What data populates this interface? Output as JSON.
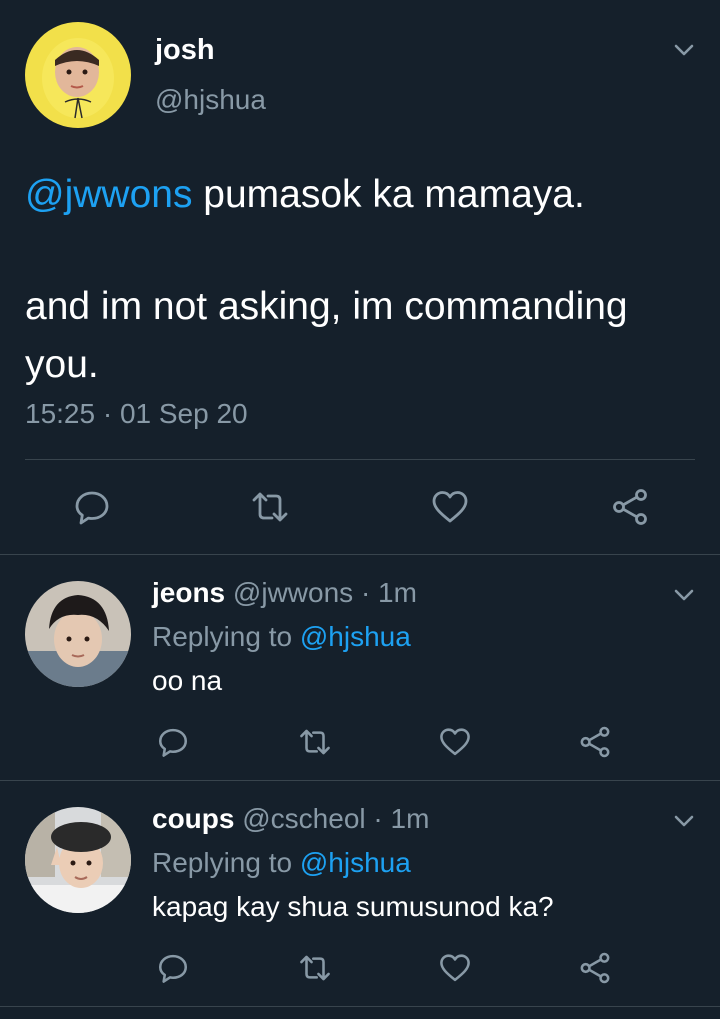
{
  "main": {
    "name": "josh",
    "handle": "@hjshua",
    "mention": "@jwwons",
    "text_line1": " pumasok ka mamaya.",
    "text_para2": "and im not asking, im commanding you.",
    "timestamp": "15:25 · 01 Sep 20"
  },
  "replies": [
    {
      "name": "jeons",
      "handle": "@jwwons",
      "time": "· 1m",
      "replying_label": "Replying to ",
      "replying_to": "@hjshua",
      "text": "oo na"
    },
    {
      "name": "coups",
      "handle": "@cscheol",
      "time": "· 1m",
      "replying_label": "Replying to ",
      "replying_to": "@hjshua",
      "text": "kapag kay shua sumusunod ka?"
    }
  ],
  "colors": {
    "background": "#15202b",
    "muted": "#8899a6",
    "accent": "#1da1f2",
    "divider": "#38444d"
  },
  "icons": [
    "chevron-down-icon",
    "reply-icon",
    "retweet-icon",
    "like-icon",
    "share-icon"
  ]
}
